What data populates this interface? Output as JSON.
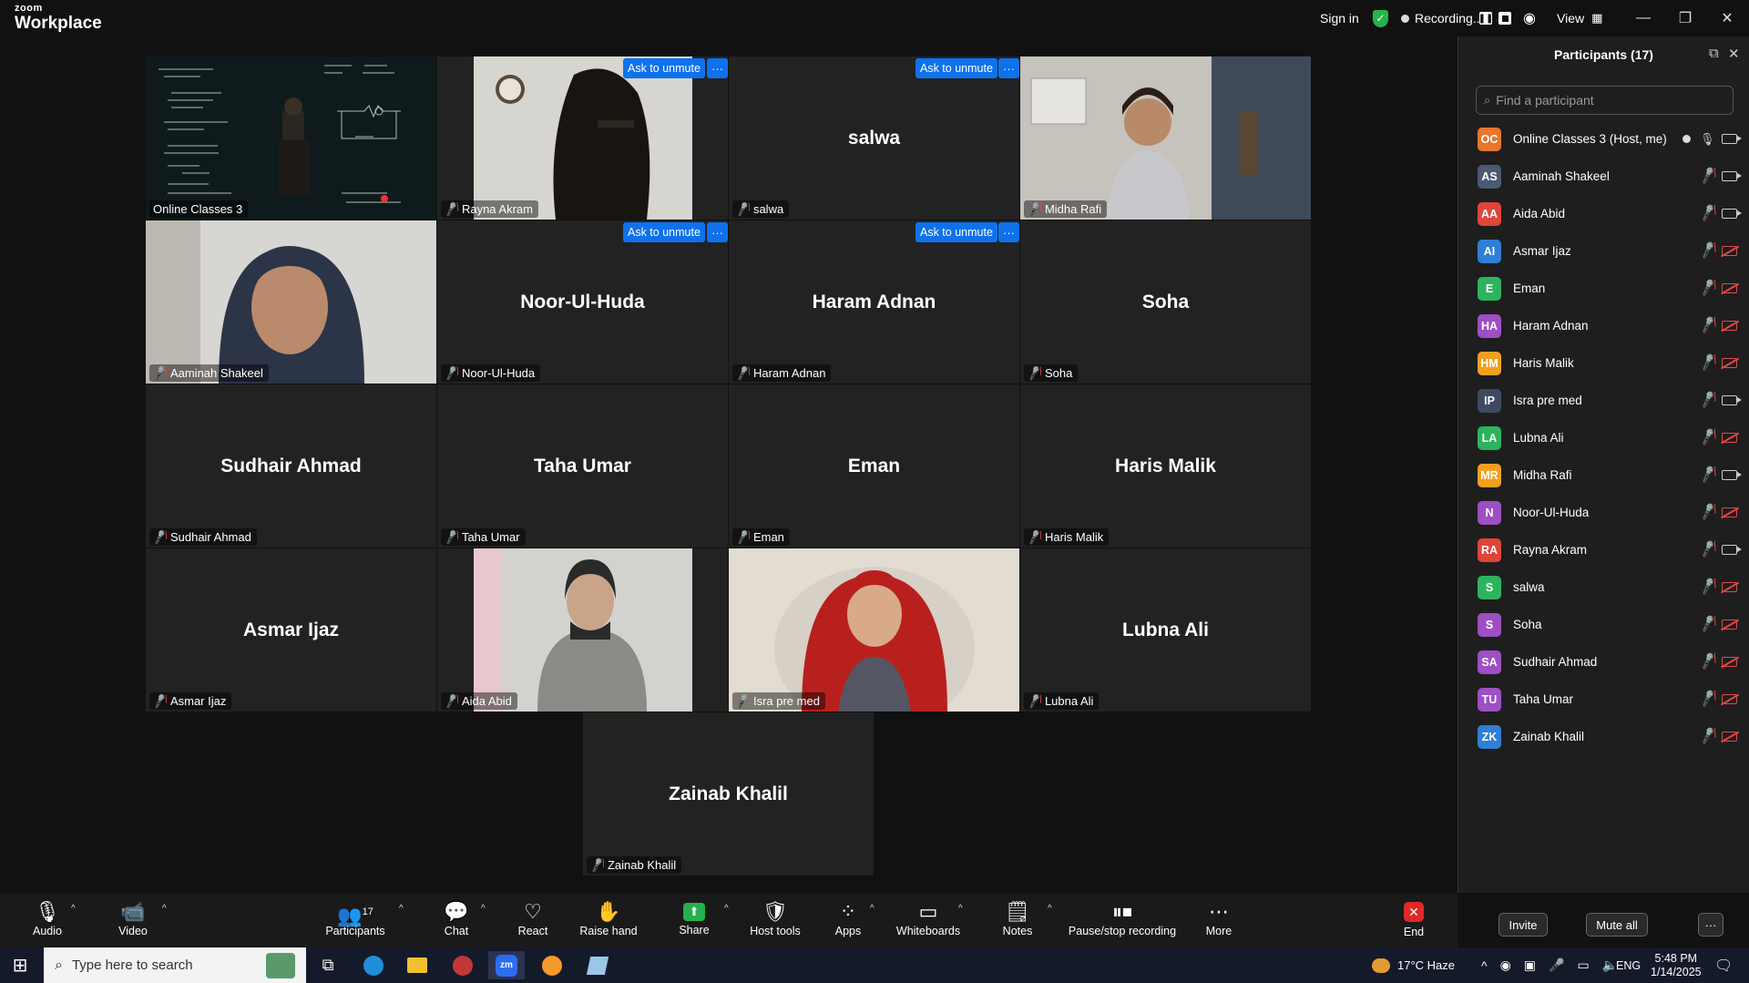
{
  "titlebar": {
    "logo_top": "zoom",
    "logo_bottom": "Workplace",
    "sign_in": "Sign in",
    "recording": "Recording...",
    "view": "View"
  },
  "tiles": {
    "online_classes": "Online Classes 3",
    "rayna": "Rayna Akram",
    "salwa": "salwa",
    "midha": "Midha Rafi",
    "aaminah": "Aaminah Shakeel",
    "noor": "Noor-Ul-Huda",
    "haram": "Haram Adnan",
    "soha": "Soha",
    "sudhair": "Sudhair Ahmad",
    "taha": "Taha Umar",
    "eman": "Eman",
    "haris": "Haris Malik",
    "asmar": "Asmar Ijaz",
    "aida": "Aida Abid",
    "isra": "Isra pre med",
    "lubna": "Lubna Ali",
    "zainab": "Zainab Khalil",
    "ask_to_unmute": "Ask to unmute",
    "more": "···"
  },
  "panel": {
    "title": "Participants (17)",
    "search_placeholder": "Find a participant",
    "invite": "Invite",
    "mute_all": "Mute all",
    "more": "···",
    "participants": [
      {
        "initials": "OC",
        "name": "Online Classes 3 (Host, me)",
        "color": "#e8762b"
      },
      {
        "initials": "AS",
        "name": "Aaminah Shakeel",
        "color": "#4a5a70"
      },
      {
        "initials": "AA",
        "name": "Aida Abid",
        "color": "#e0453a"
      },
      {
        "initials": "AI",
        "name": "Asmar Ijaz",
        "color": "#2f7fd6"
      },
      {
        "initials": "E",
        "name": "Eman",
        "color": "#2db35e"
      },
      {
        "initials": "HA",
        "name": "Haram Adnan",
        "color": "#9d4fc4"
      },
      {
        "initials": "HM",
        "name": "Haris Malik",
        "color": "#f0a020"
      },
      {
        "initials": "IP",
        "name": "Isra pre med",
        "color": "#3d4a60"
      },
      {
        "initials": "LA",
        "name": "Lubna Ali",
        "color": "#2db35e"
      },
      {
        "initials": "MR",
        "name": "Midha Rafi",
        "color": "#f0a020"
      },
      {
        "initials": "N",
        "name": "Noor-Ul-Huda",
        "color": "#9d4fc4"
      },
      {
        "initials": "RA",
        "name": "Rayna Akram",
        "color": "#e0453a"
      },
      {
        "initials": "S",
        "name": "salwa",
        "color": "#2db35e"
      },
      {
        "initials": "S",
        "name": "Soha",
        "color": "#9d4fc4"
      },
      {
        "initials": "SA",
        "name": "Sudhair Ahmad",
        "color": "#9d4fc4"
      },
      {
        "initials": "TU",
        "name": "Taha Umar",
        "color": "#9d4fc4"
      },
      {
        "initials": "ZK",
        "name": "Zainab Khalil",
        "color": "#2f7fd6"
      }
    ]
  },
  "toolbar": {
    "audio": "Audio",
    "video": "Video",
    "participants": "Participants",
    "participants_count": "17",
    "chat": "Chat",
    "react": "React",
    "raise_hand": "Raise hand",
    "share": "Share",
    "host_tools": "Host tools",
    "apps": "Apps",
    "whiteboards": "Whiteboards",
    "notes": "Notes",
    "pause_stop": "Pause/stop recording",
    "more": "More",
    "end": "End"
  },
  "taskbar": {
    "search_placeholder": "Type here to search",
    "weather": "17°C  Haze",
    "lang": "ENG",
    "time": "5:48 PM",
    "date": "1/14/2025"
  }
}
